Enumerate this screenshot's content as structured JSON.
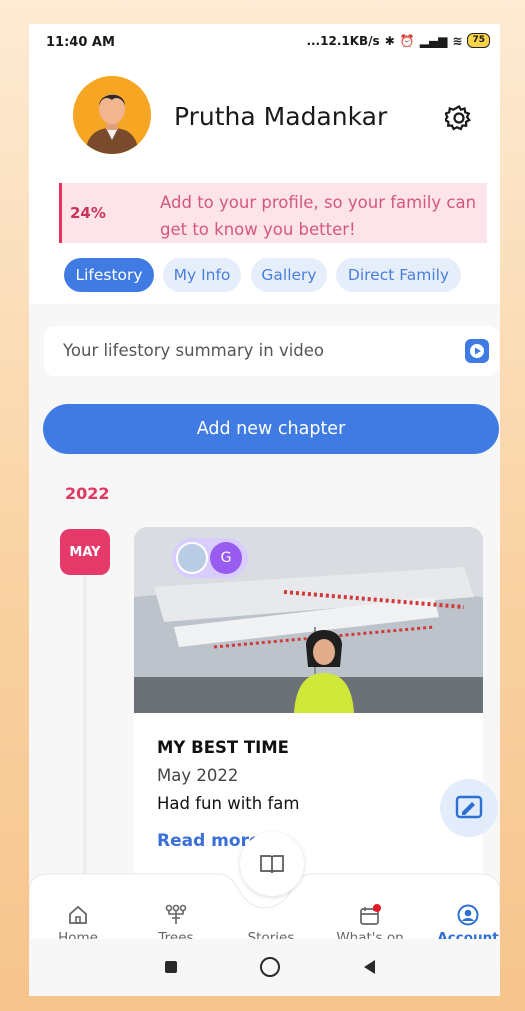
{
  "status_bar": {
    "time": "11:40 AM",
    "network_speed": "...12.1KB/s",
    "battery": "75"
  },
  "profile": {
    "name": "Prutha Madankar",
    "avatar_icon": "user-avatar",
    "settings_icon": "gear-icon"
  },
  "banner": {
    "percent": "24%",
    "message": "Add to your profile, so your family can get to know you better!"
  },
  "tabs": [
    {
      "label": "Lifestory",
      "active": true
    },
    {
      "label": "My Info",
      "active": false
    },
    {
      "label": "Gallery",
      "active": false
    },
    {
      "label": "Direct Family",
      "active": false
    }
  ],
  "summary": {
    "placeholder": "Your lifestory summary in video",
    "icon": "video-play-icon"
  },
  "add_chapter_label": "Add new chapter",
  "timeline": {
    "year": "2022",
    "month": "MAY"
  },
  "chapter_card": {
    "title": "MY BEST TIME",
    "date": "May 2022",
    "description": "Had fun with fam",
    "read_more": "Read more",
    "tag_letter": "G"
  },
  "bottom_nav": [
    {
      "label": "Home",
      "icon": "home-icon"
    },
    {
      "label": "Trees",
      "icon": "tree-icon"
    },
    {
      "label": "Stories",
      "icon": "book-icon"
    },
    {
      "label": "What's on",
      "icon": "calendar-icon"
    },
    {
      "label": "Account",
      "icon": "account-icon",
      "active": true
    }
  ],
  "colors": {
    "accent": "#3f7be3",
    "pink": "#e5396a",
    "banner_bg": "#fde3ea"
  }
}
